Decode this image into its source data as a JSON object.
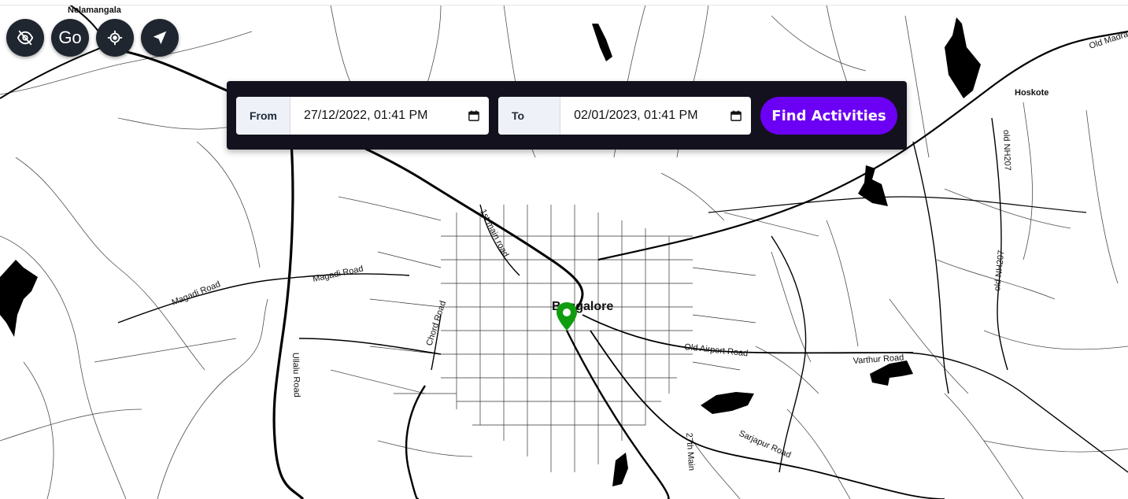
{
  "map": {
    "place_labels": [
      {
        "text": "Nelamangala"
      },
      {
        "text": "Hoskote"
      },
      {
        "text": "Bangalore"
      }
    ],
    "road_labels": [
      {
        "text": "Magadi Road"
      },
      {
        "text": "Magadi Road"
      },
      {
        "text": "1st main road"
      },
      {
        "text": "Chord Road"
      },
      {
        "text": "Ullalu Road"
      },
      {
        "text": "Old Airport Road"
      },
      {
        "text": "Varthur Road"
      },
      {
        "text": "Sarjapur Road"
      },
      {
        "text": "27th Main"
      },
      {
        "text": "old NH207"
      },
      {
        "text": "old NH207"
      },
      {
        "text": "Old Madra"
      }
    ],
    "marker": {
      "icon": "map-pin-icon",
      "color": "#0f9d0f"
    }
  },
  "controls": {
    "hide_icon": "eye-off-icon",
    "go_label": "Go",
    "locate_icon": "crosshair-icon",
    "navigate_icon": "navigation-arrow-icon"
  },
  "search": {
    "from_label": "From",
    "from_value": "27/12/2022, 01:41 PM",
    "to_label": "To",
    "to_value": "02/01/2023, 01:41 PM",
    "find_label": "Find Activities",
    "accent": "#6b00f5"
  }
}
